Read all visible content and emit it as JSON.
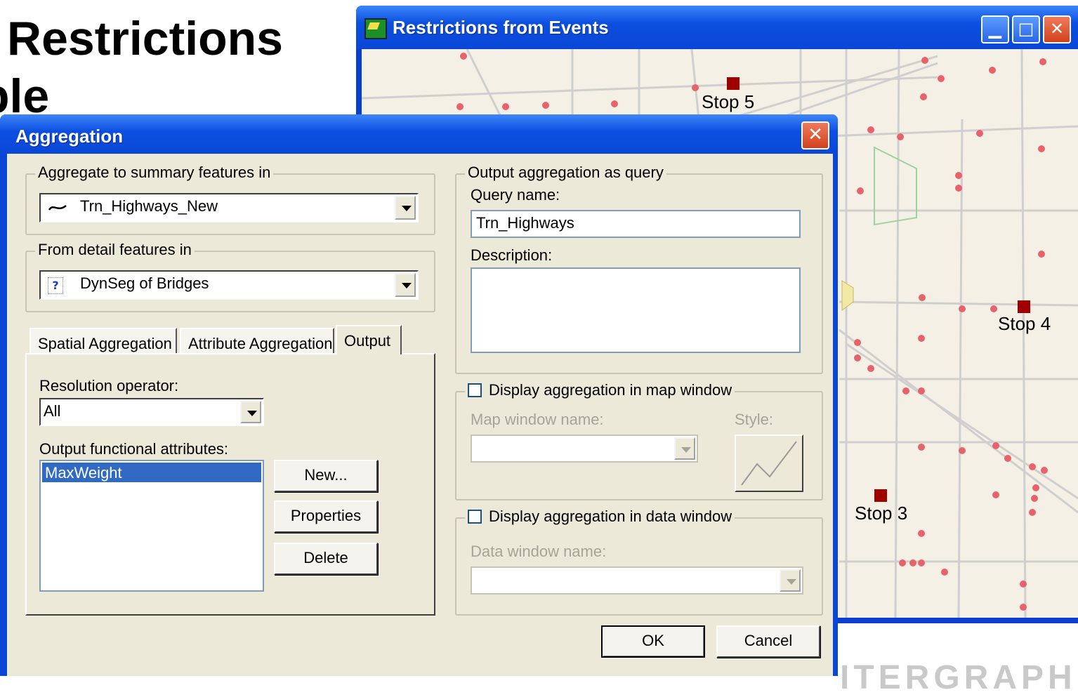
{
  "slide": {
    "title_line1": "Restrictions",
    "title_line2": "ple",
    "fragment1": "",
    "fragment2": "i"
  },
  "map_window": {
    "title": "Restrictions from Events",
    "stops": [
      "Stop 5",
      "Stop 4",
      "Stop 3"
    ]
  },
  "dialog": {
    "title": "Aggregation",
    "aggregate_group": "Aggregate to summary features in",
    "aggregate_value": "Trn_Highways_New",
    "from_group": "From detail features in",
    "from_value": "DynSeg of Bridges",
    "tabs": [
      "Spatial Aggregation",
      "Attribute Aggregation",
      "Output"
    ],
    "resolution_label": "Resolution operator:",
    "resolution_value": "All",
    "output_attrs_label": "Output functional attributes:",
    "output_attrs": [
      "MaxWeight"
    ],
    "new_button": "New...",
    "properties_button": "Properties",
    "delete_button": "Delete",
    "query_group": "Output aggregation as query",
    "query_name_label": "Query name:",
    "query_name_value": "Trn_Highways",
    "description_label": "Description:",
    "description_value": "",
    "map_check_label": "Display aggregation in map window",
    "map_window_name_label": "Map window name:",
    "style_label": "Style:",
    "data_check_label": "Display aggregation in data window",
    "data_window_name_label": "Data window name:",
    "ok_button": "OK",
    "cancel_button": "Cancel"
  },
  "colors": {
    "titlebar": "#0a46d6",
    "dialog_bg": "#ece9d8",
    "selection": "#316ac5",
    "map_bg": "#f5f0e5",
    "road": "#c8c8c8",
    "event_point": "#e8626b",
    "stop_marker": "#a00000"
  },
  "icons": {
    "map_title": "map-app-icon",
    "aggregate_combo": "line-feature-icon",
    "from_combo": "query-feature-icon"
  }
}
